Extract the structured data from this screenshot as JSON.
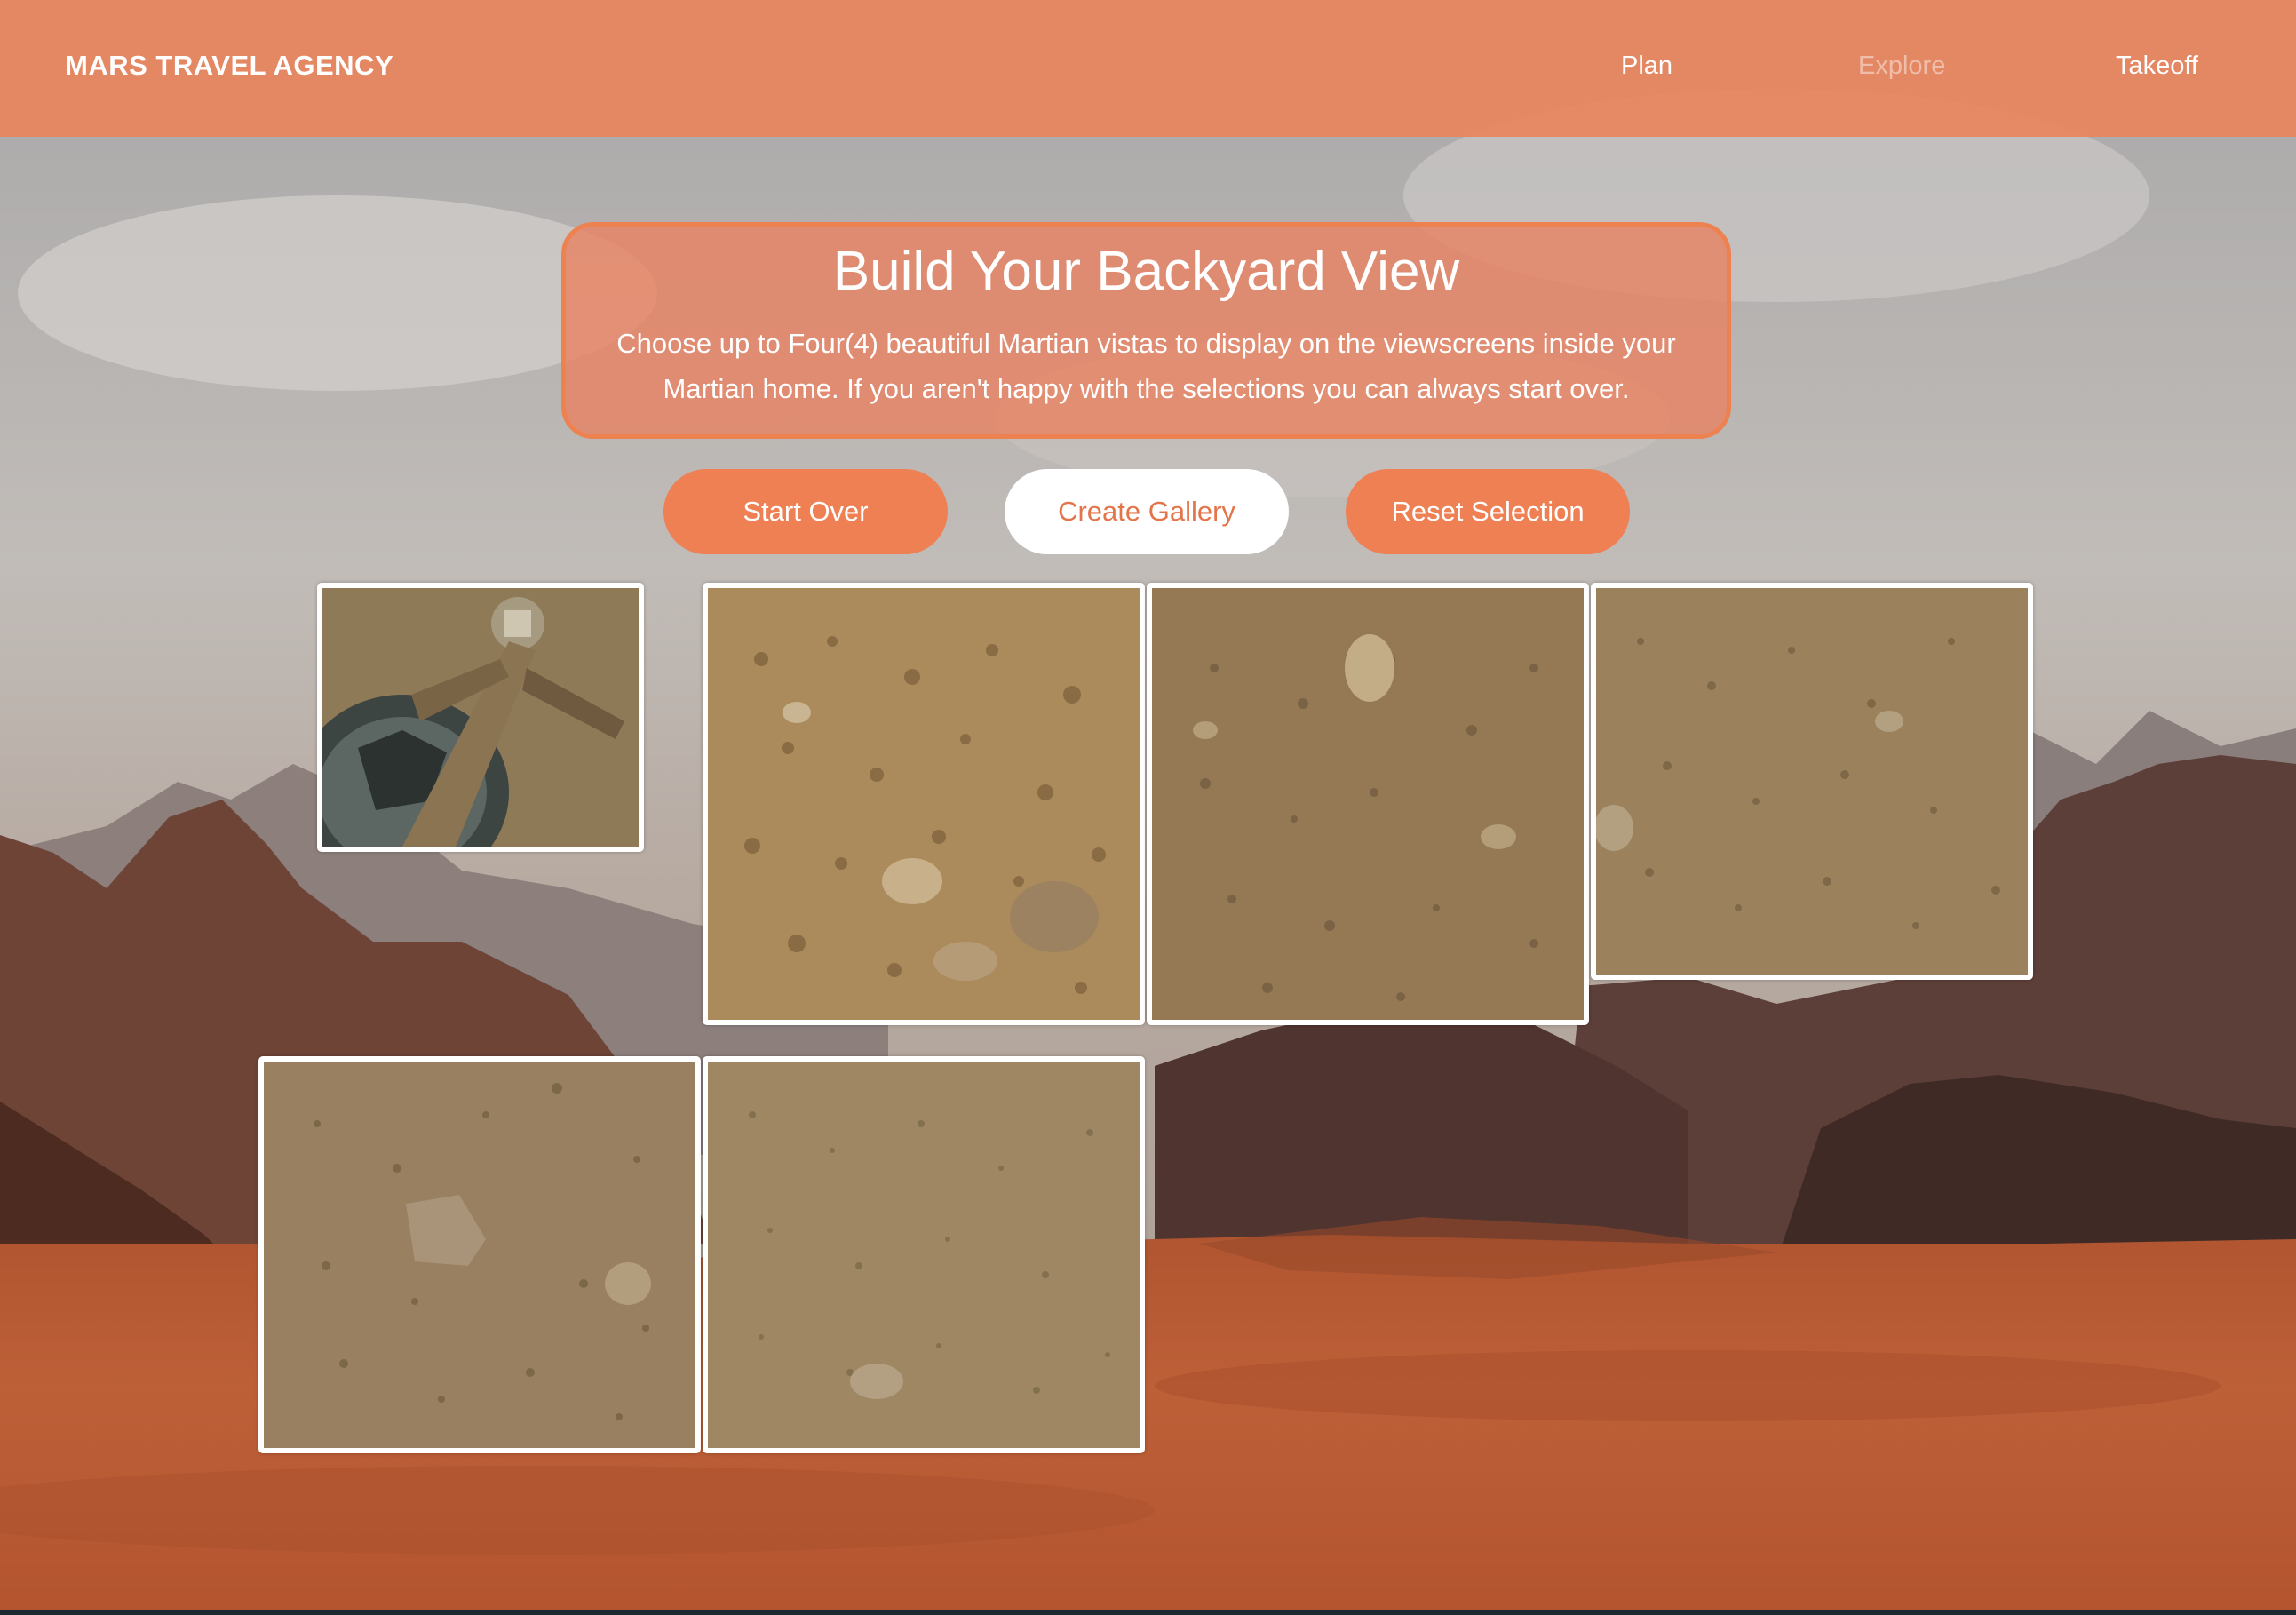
{
  "nav": {
    "brand": "MARS TRAVEL AGENCY",
    "links": [
      {
        "label": "Plan",
        "active": false
      },
      {
        "label": "Explore",
        "active": true
      },
      {
        "label": "Takeoff",
        "active": false
      }
    ]
  },
  "intro": {
    "title": "Build Your Backyard View",
    "description": "Choose up to Four(4) beautiful Martian vistas to display on the viewscreens inside your Martian home. If you aren't happy with the selections you can always start over."
  },
  "buttons": {
    "start_over": "Start Over",
    "create_gallery": "Create Gallery",
    "reset_selection": "Reset Selection"
  },
  "gallery": {
    "tiles": [
      {
        "subject": "rover-hardware-closeup"
      },
      {
        "subject": "pebbly-martian-ground"
      },
      {
        "subject": "martian-ground-with-rock"
      },
      {
        "subject": "fine-gravel-plain"
      },
      {
        "subject": "gravel-with-flat-stone"
      },
      {
        "subject": "sandy-gravel-field"
      }
    ]
  },
  "colors": {
    "accent": "#ee8053",
    "nav_background": "#e8865f",
    "button_text_light": "#e4744a"
  }
}
